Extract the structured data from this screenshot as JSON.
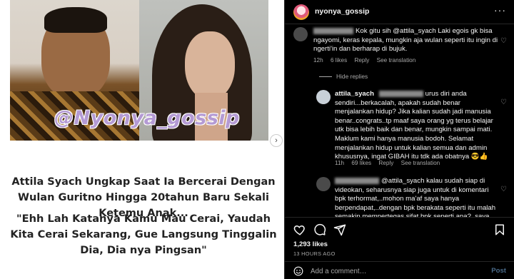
{
  "post": {
    "watermark": "@Nyonya_gossip",
    "headline": "Attila Syach Ungkap Saat Ia Bercerai Dengan Wulan Guritno Hingga 20tahun Baru Sekali Ketemu Anak...",
    "quote": "\"Ehh Lah Katanya Kamu Mau Cerai, Yaudah Kita Cerai Sekarang, Gue Langsung Tinggalin Dia, Dia nya Pingsan\"",
    "carousel_icon": "›"
  },
  "header": {
    "username": "nyonya_gossip",
    "more_icon": "···"
  },
  "comments": [
    {
      "text": "Kok gitu sih @attila_syach Laki egois gk bisa ngayomi, keras kepala, mungkin aja wulan seperti itu ingin di ngerti'in dan berharap di bujuk.",
      "time": "12h",
      "likes": "6 likes",
      "reply": "Reply",
      "translate": "See translation"
    },
    {
      "username": "attila_syach",
      "text": "urus diri anda sendiri...berkacalah, apakah sudah benar menjalankan hidup? Jika kalian sudah jadi manusia benar..congrats..tp maaf saya orang yg terus belajar utk bisa lebih baik dan benar, mungkin sampai mati. Maklum kami hanya manusia bodoh. Selamat menjalankan hidup untuk kalian semua dan admin khususnya, ingat GIBAH itu tdk ada obatnya 😎👍",
      "time": "11h",
      "likes": "69 likes",
      "reply": "Reply",
      "translate": "See translation"
    },
    {
      "text": "@attila_syach kalau sudah siap di videokan, seharusnya siap juga untuk di komentari bpk terhormat,..mohon ma'af saya hanya berpendapat,..dengan bpk berakata seperti itu malah semakin mempertegas sifat bpk seperti apa?..saya"
    }
  ],
  "hide_replies": "Hide replies",
  "likes_count": "1,293 likes",
  "time_ago": "13 HOURS AGO",
  "add_comment": {
    "placeholder": "Add a comment…",
    "post_label": "Post"
  }
}
